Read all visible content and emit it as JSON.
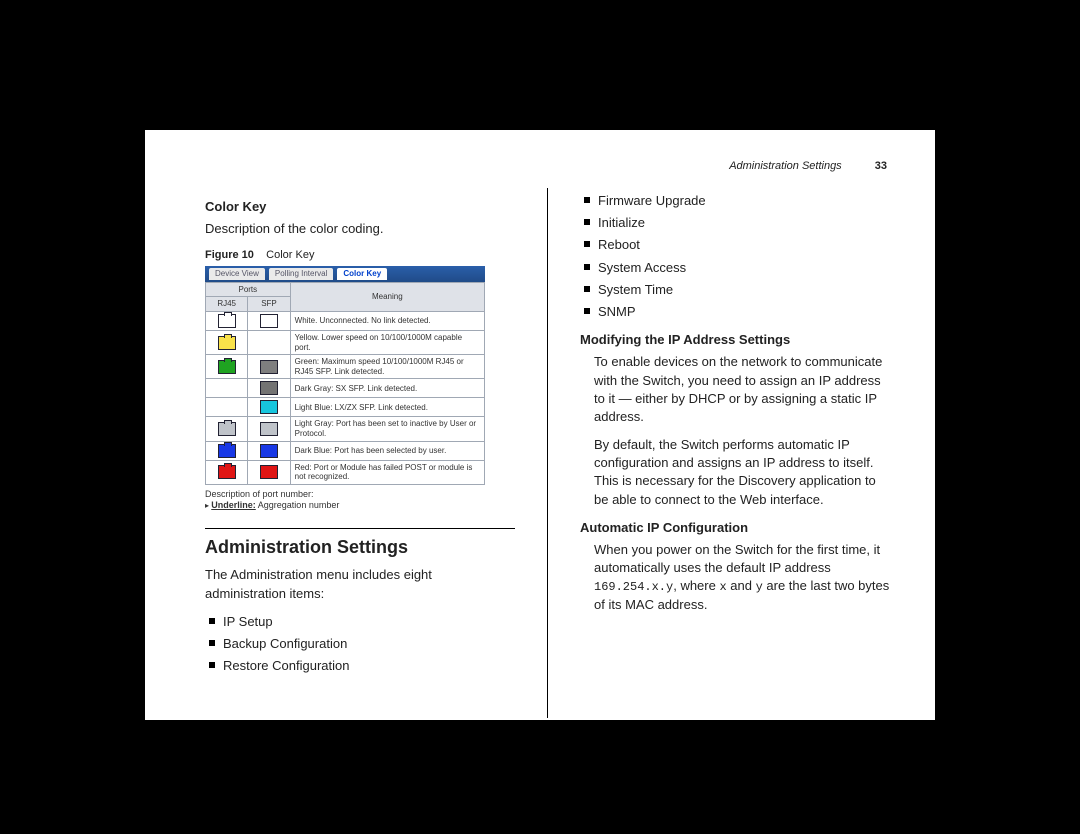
{
  "header": {
    "running_title": "Administration Settings",
    "page_number": "33"
  },
  "left": {
    "color_key_heading": "Color Key",
    "color_key_desc": "Description of the color coding.",
    "figure_label": "Figure 10",
    "figure_title": "Color Key",
    "tabs": {
      "device_view": "Device View",
      "polling_interval": "Polling Interval",
      "color_key": "Color Key"
    },
    "table": {
      "ports_head": "Ports",
      "rj45_head": "RJ45",
      "sfp_head": "SFP",
      "meaning_head": "Meaning",
      "rows": [
        {
          "rj45_color": "#ffffff",
          "sfp_color": "#ffffff",
          "meaning": "White. Unconnected. No link detected."
        },
        {
          "rj45_color": "#f9e24a",
          "sfp_color": "",
          "meaning": "Yellow. Lower speed on 10/100/1000M capable port."
        },
        {
          "rj45_color": "#1fa321",
          "sfp_color": "#7f7f7f",
          "meaning": "Green: Maximum speed 10/100/1000M RJ45 or RJ45 SFP. Link detected."
        },
        {
          "rj45_color": "",
          "sfp_color": "#737373",
          "meaning": "Dark Gray: SX SFP. Link detected."
        },
        {
          "rj45_color": "",
          "sfp_color": "#17c6de",
          "meaning": "Light Blue: LX/ZX SFP. Link detected."
        },
        {
          "rj45_color": "#bfc3c9",
          "sfp_color": "#bfc3c9",
          "meaning": "Light Gray: Port has been set to inactive by User or Protocol."
        },
        {
          "rj45_color": "#1838e6",
          "sfp_color": "#1838e6",
          "meaning": "Dark Blue: Port has been selected by user."
        },
        {
          "rj45_color": "#e01515",
          "sfp_color": "#e01515",
          "meaning": "Red: Port or Module has failed POST or module is not recognized."
        }
      ]
    },
    "footnote1": "Description of port number:",
    "footnote2_label": "Underline:",
    "footnote2_text": "Aggregation number",
    "admin_heading": "Administration Settings",
    "admin_intro": "The Administration menu includes eight administration items:",
    "admin_items_left": [
      "IP Setup",
      "Backup Configuration",
      "Restore Configuration"
    ]
  },
  "right": {
    "admin_items_right": [
      "Firmware Upgrade",
      "Initialize",
      "Reboot",
      "System Access",
      "System Time",
      "SNMP"
    ],
    "mod_ip_heading": "Modifying the IP Address Settings",
    "mod_ip_p1": "To enable devices on the network to communicate with the Switch, you need to assign an IP address to it — either by DHCP or by assigning a static IP address.",
    "mod_ip_p2": "By default, the Switch performs automatic IP configuration and assigns an IP address to itself. This is necessary for the Discovery application to be able to connect to the Web interface.",
    "auto_ip_heading": "Automatic IP Configuration",
    "auto_ip_p1_a": "When you power on the Switch for the first time, it automatically uses the default IP address ",
    "auto_ip_code": "169.254.x.y",
    "auto_ip_p1_b": ", where ",
    "auto_ip_x": "x",
    "auto_ip_p1_c": " and ",
    "auto_ip_y": "y",
    "auto_ip_p1_d": " are the last two bytes of its MAC address."
  }
}
